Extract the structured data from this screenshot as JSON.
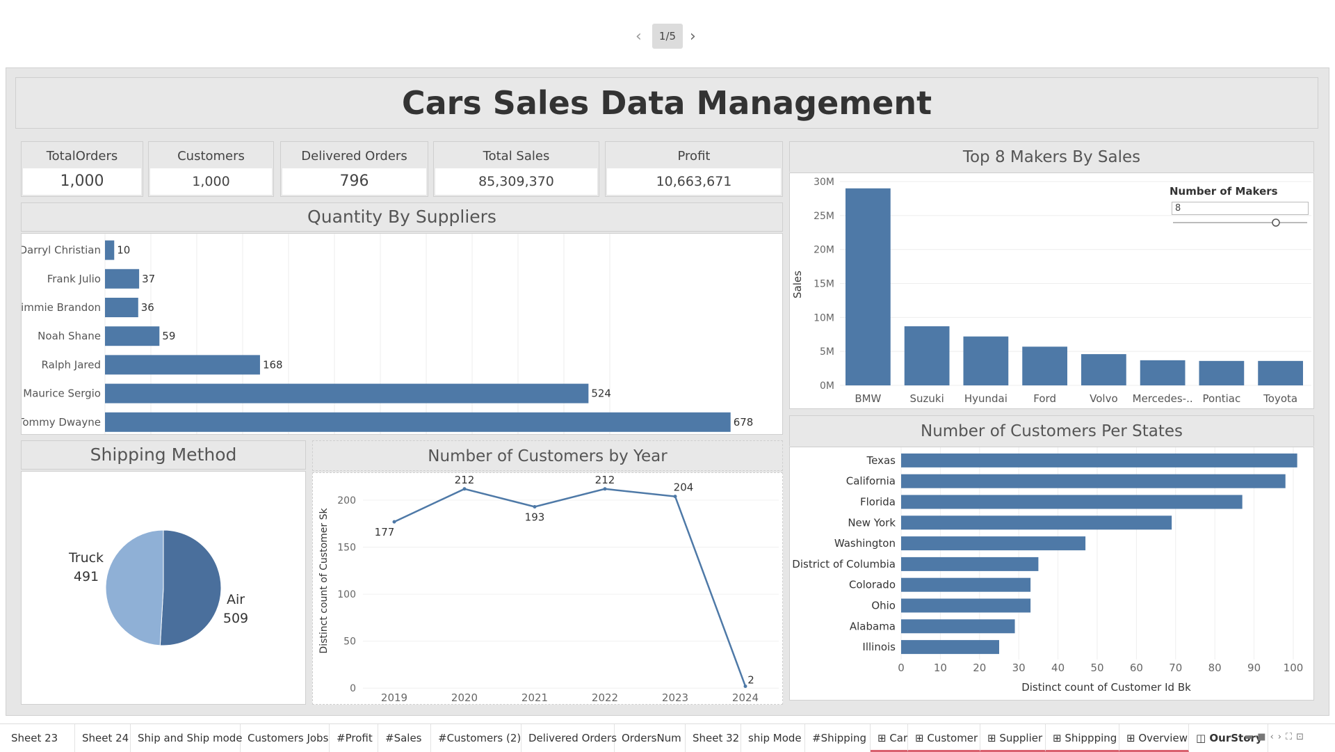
{
  "pager": {
    "label": "1/5",
    "prev_icon": "chevron-left-icon",
    "next_icon": "chevron-right-icon"
  },
  "title": "Cars Sales Data Management",
  "kpis": [
    {
      "label": "TotalOrders",
      "value": "1,000"
    },
    {
      "label": "Customers",
      "value": "1,000"
    },
    {
      "label": "Delivered Orders",
      "value": "796"
    },
    {
      "label": "Total Sales",
      "value": "85,309,370"
    },
    {
      "label": "Profit",
      "value": "10,663,671"
    }
  ],
  "colors": {
    "bar": "#4e79a7",
    "pie_light": "#8fb0d6",
    "pie_dark": "#4a6f9c",
    "tab_underline": "#d9606e"
  },
  "suppliers": {
    "title": "Quantity By Suppliers"
  },
  "makers": {
    "title": "Top 8 Makers By Sales",
    "filter_label": "Number of Makers",
    "filter_value": "8",
    "ylabel": "Sales"
  },
  "shipping": {
    "title": "Shipping Method"
  },
  "customers_year": {
    "title": "Number of Customers by Year",
    "ylabel": "Distinct count of Customer Sk"
  },
  "states": {
    "title": "Number of Customers Per States",
    "xlabel": "Distinct count of Customer Id Bk"
  },
  "chart_data": [
    {
      "type": "bar",
      "orientation": "horizontal",
      "title": "Quantity By Suppliers",
      "categories": [
        "Darryl Christian",
        "Frank Julio",
        "Jimmie Brandon",
        "Noah Shane",
        "Ralph Jared",
        "Maurice Sergio",
        "Tommy Dwayne"
      ],
      "values": [
        10,
        37,
        36,
        59,
        168,
        524,
        678
      ],
      "xlim": [
        0,
        720
      ],
      "grid": true
    },
    {
      "type": "bar",
      "title": "Top 8 Makers By Sales",
      "ylabel": "Sales",
      "categories": [
        "BMW",
        "Suzuki",
        "Hyundai",
        "Ford",
        "Volvo",
        "Mercedes-..",
        "Pontiac",
        "Toyota"
      ],
      "values": [
        29000000,
        8700000,
        7200000,
        5700000,
        4600000,
        3700000,
        3600000,
        3600000
      ],
      "yticks": [
        "0M",
        "5M",
        "10M",
        "15M",
        "20M",
        "25M",
        "30M"
      ],
      "ylim": [
        0,
        30000000
      ],
      "grid": true
    },
    {
      "type": "pie",
      "title": "Shipping Method",
      "labels": [
        "Air",
        "Truck"
      ],
      "values": [
        509,
        491
      ]
    },
    {
      "type": "line",
      "title": "Number of Customers by Year",
      "ylabel": "Distinct count of Customer Sk",
      "x": [
        "2019",
        "2020",
        "2021",
        "2022",
        "2023",
        "2024"
      ],
      "values": [
        177,
        212,
        193,
        212,
        204,
        2
      ],
      "yticks": [
        0,
        50,
        100,
        150,
        200
      ],
      "ylim": [
        -8,
        220
      ]
    },
    {
      "type": "bar",
      "orientation": "horizontal",
      "title": "Number of Customers Per States",
      "xlabel": "Distinct count of Customer Id Bk",
      "categories": [
        "Texas",
        "California",
        "Florida",
        "New York",
        "Washington",
        "District of Columbia",
        "Colorado",
        "Ohio",
        "Alabama",
        "Illinois"
      ],
      "values": [
        101,
        98,
        87,
        69,
        47,
        35,
        33,
        33,
        29,
        25
      ],
      "xticks": [
        0,
        10,
        20,
        30,
        40,
        50,
        60,
        70,
        80,
        90,
        100
      ],
      "xlim": [
        0,
        104
      ],
      "grid": true
    }
  ],
  "tabs": [
    {
      "label": "Sheet 23",
      "dashboard": false
    },
    {
      "label": "Sheet 24",
      "dashboard": false
    },
    {
      "label": "Ship and Ship mode",
      "dashboard": false
    },
    {
      "label": "Customers Jobs",
      "dashboard": false
    },
    {
      "label": "#Profit",
      "dashboard": false
    },
    {
      "label": "#Sales",
      "dashboard": false
    },
    {
      "label": "#Customers (2)",
      "dashboard": false
    },
    {
      "label": "Delivered Orders",
      "dashboard": false
    },
    {
      "label": "OrdersNum",
      "dashboard": false
    },
    {
      "label": "Sheet 32",
      "dashboard": false
    },
    {
      "label": "ship Mode",
      "dashboard": false
    },
    {
      "label": "#Shipping",
      "dashboard": false
    },
    {
      "label": "⊞ Car",
      "dashboard": true
    },
    {
      "label": "⊞ Customer",
      "dashboard": true
    },
    {
      "label": "⊞ Supplier",
      "dashboard": true
    },
    {
      "label": "⊞ Shippping",
      "dashboard": true
    },
    {
      "label": "⊞ Overview",
      "dashboard": true
    },
    {
      "label": "◫ OurStory",
      "dashboard": false,
      "active": true
    }
  ]
}
